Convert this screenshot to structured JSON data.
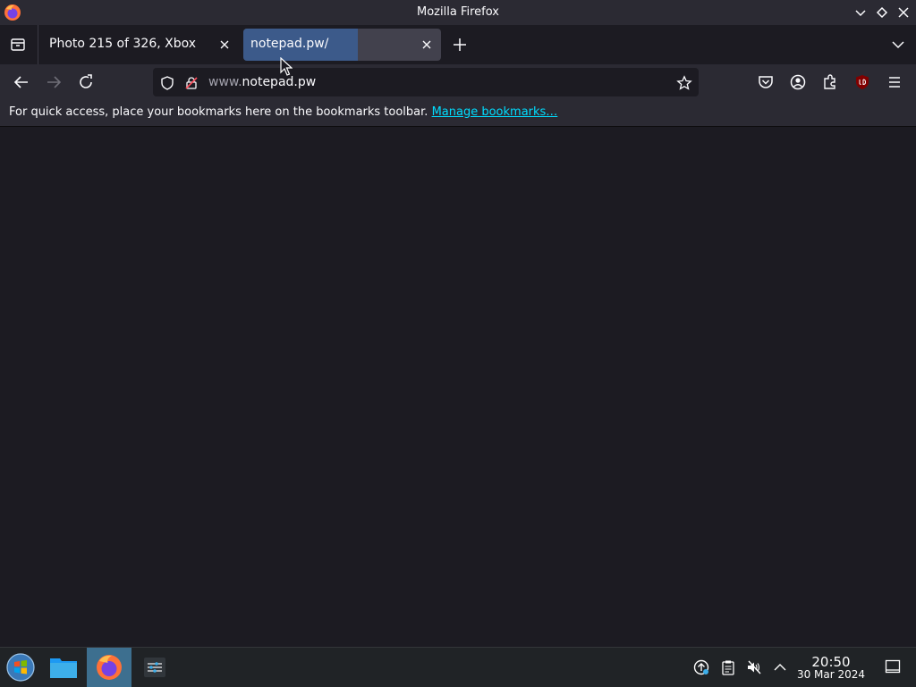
{
  "window": {
    "title": "Mozilla Firefox"
  },
  "tabs": [
    {
      "label": "Photo 215 of 326, Xbox",
      "active": false
    },
    {
      "label": "notepad.pw/",
      "active": true
    }
  ],
  "urlbar": {
    "prefix": "www.",
    "domain": "notepad.pw"
  },
  "bookmarks_bar": {
    "message": "For quick access, place your bookmarks here on the bookmarks toolbar.",
    "link": "Manage bookmarks…"
  },
  "clock": {
    "time": "20:50",
    "date": "30 Mar 2024"
  },
  "colors": {
    "accent": "#00ddff",
    "chrome": "#2b2a33",
    "content": "#1c1b22",
    "tab_highlight": "#3c5a8a"
  }
}
